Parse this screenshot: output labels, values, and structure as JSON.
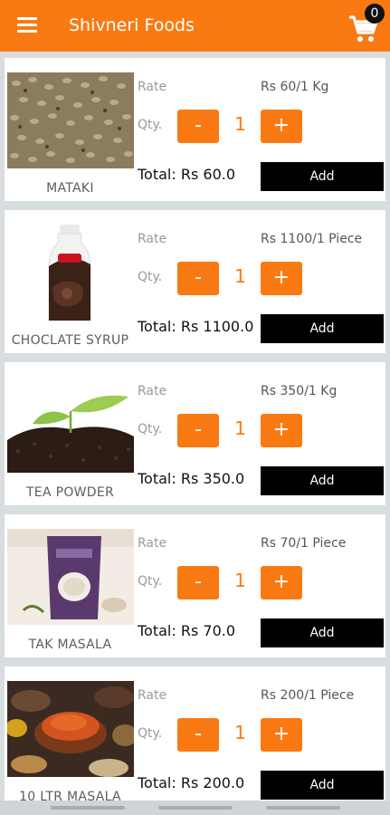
{
  "app": {
    "title": "Shivneri Foods",
    "cart_count": "0",
    "accent_color": "#f97a12"
  },
  "labels": {
    "rate": "Rate",
    "qty": "Qty.",
    "minus": "-",
    "plus": "+",
    "add": "Add"
  },
  "products": [
    {
      "name": "MATAKI",
      "rate": "Rs 60/1 Kg",
      "qty": "1",
      "total": "Total: Rs 60.0",
      "image": "mataki-beans"
    },
    {
      "name": "CHOCLATE SYRUP",
      "rate": "Rs 1100/1 Piece",
      "qty": "1",
      "total": "Total: Rs 1100.0",
      "image": "chocolate-syrup-bottle"
    },
    {
      "name": "TEA POWDER",
      "rate": "Rs 350/1 Kg",
      "qty": "1",
      "total": "Total: Rs 350.0",
      "image": "tea-powder-sprout"
    },
    {
      "name": "TAK MASALA",
      "rate": "Rs 70/1 Piece",
      "qty": "1",
      "total": "Total: Rs 70.0",
      "image": "tak-masala-pack"
    },
    {
      "name": "10 LTR MASALA",
      "rate": "Rs 200/1 Piece",
      "qty": "1",
      "total": "Total: Rs 200.0",
      "image": "spice-bowls"
    }
  ]
}
